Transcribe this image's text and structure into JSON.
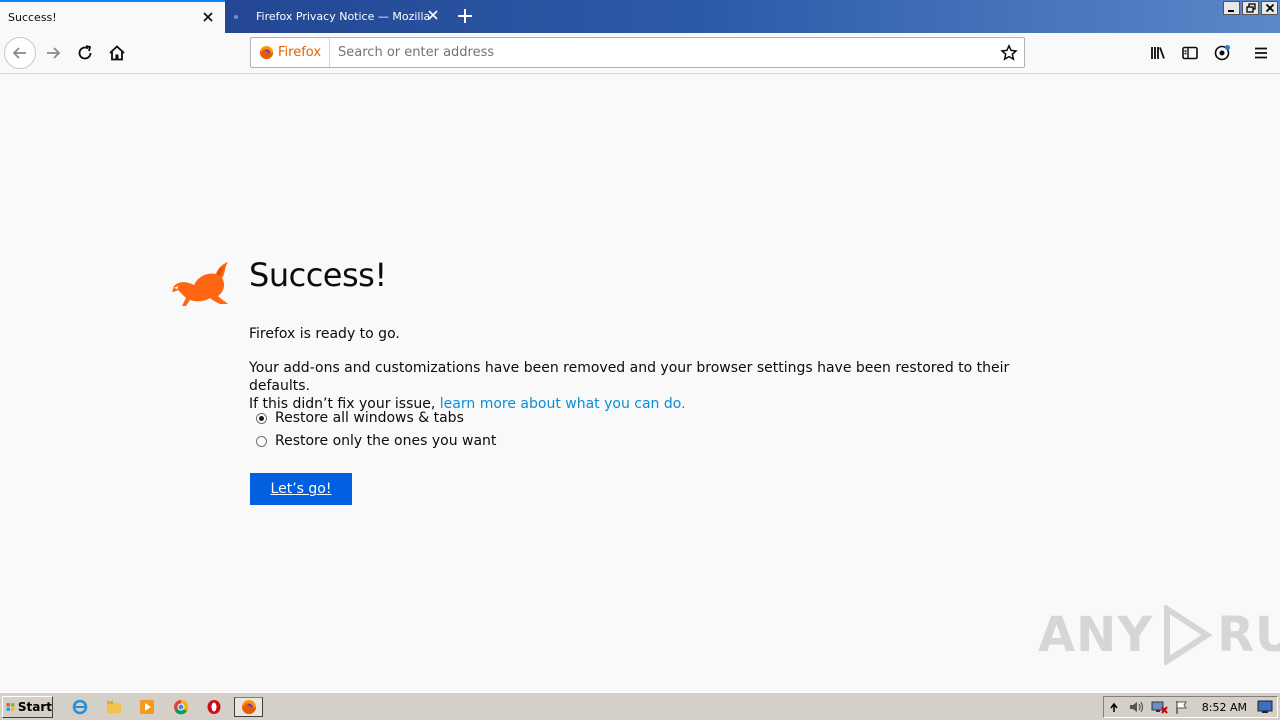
{
  "tabs": [
    {
      "title": "Success!",
      "active": true
    },
    {
      "title": "Firefox Privacy Notice — Mozilla",
      "active": false
    }
  ],
  "urlbar": {
    "identity_label": "Firefox",
    "placeholder": "Search or enter address"
  },
  "content": {
    "title": "Success!",
    "ready_text": "Firefox is ready to go.",
    "info_text": "Your add-ons and customizations have been removed and your browser settings have been restored to their defaults.",
    "info_text_2": "If this didn’t fix your issue, ",
    "learn_more_link": "learn more about what you can do.",
    "options": [
      {
        "label": "Restore all windows & tabs",
        "selected": true
      },
      {
        "label": "Restore only the ones you want",
        "selected": false
      }
    ],
    "go_button": "Let’s go!"
  },
  "watermark": {
    "left": "ANY",
    "right": "RUN"
  },
  "taskbar": {
    "start_label": "Start",
    "clock": "8:52 AM"
  },
  "colors": {
    "accent_blue": "#0060df",
    "link_blue": "#0a8dd9",
    "firefox_orange": "#e66000",
    "tab_strip": "#2d5aa8"
  }
}
